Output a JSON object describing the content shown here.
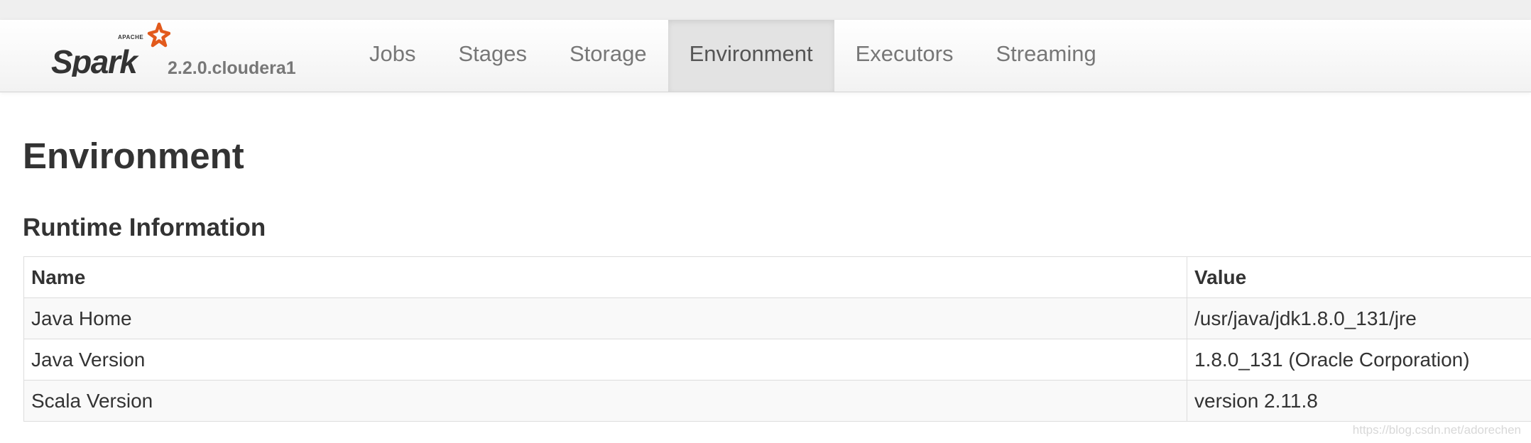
{
  "header": {
    "logo": {
      "icon": "apache-spark-logo",
      "wordmark_small": "APACHE",
      "wordmark": "Spark",
      "colors": {
        "text": "#333333",
        "star": "#e25a1c"
      }
    },
    "version": "2.2.0.cloudera1",
    "tabs": [
      {
        "label": "Jobs",
        "active": false
      },
      {
        "label": "Stages",
        "active": false
      },
      {
        "label": "Storage",
        "active": false
      },
      {
        "label": "Environment",
        "active": true
      },
      {
        "label": "Executors",
        "active": false
      },
      {
        "label": "Streaming",
        "active": false
      }
    ]
  },
  "main": {
    "title": "Environment",
    "section_title": "Runtime Information",
    "table": {
      "columns": [
        "Name",
        "Value"
      ],
      "rows": [
        [
          "Java Home",
          "/usr/java/jdk1.8.0_131/jre"
        ],
        [
          "Java Version",
          "1.8.0_131 (Oracle Corporation)"
        ],
        [
          "Scala Version",
          "version 2.11.8"
        ]
      ]
    }
  },
  "watermark": "https://blog.csdn.net/adorechen"
}
